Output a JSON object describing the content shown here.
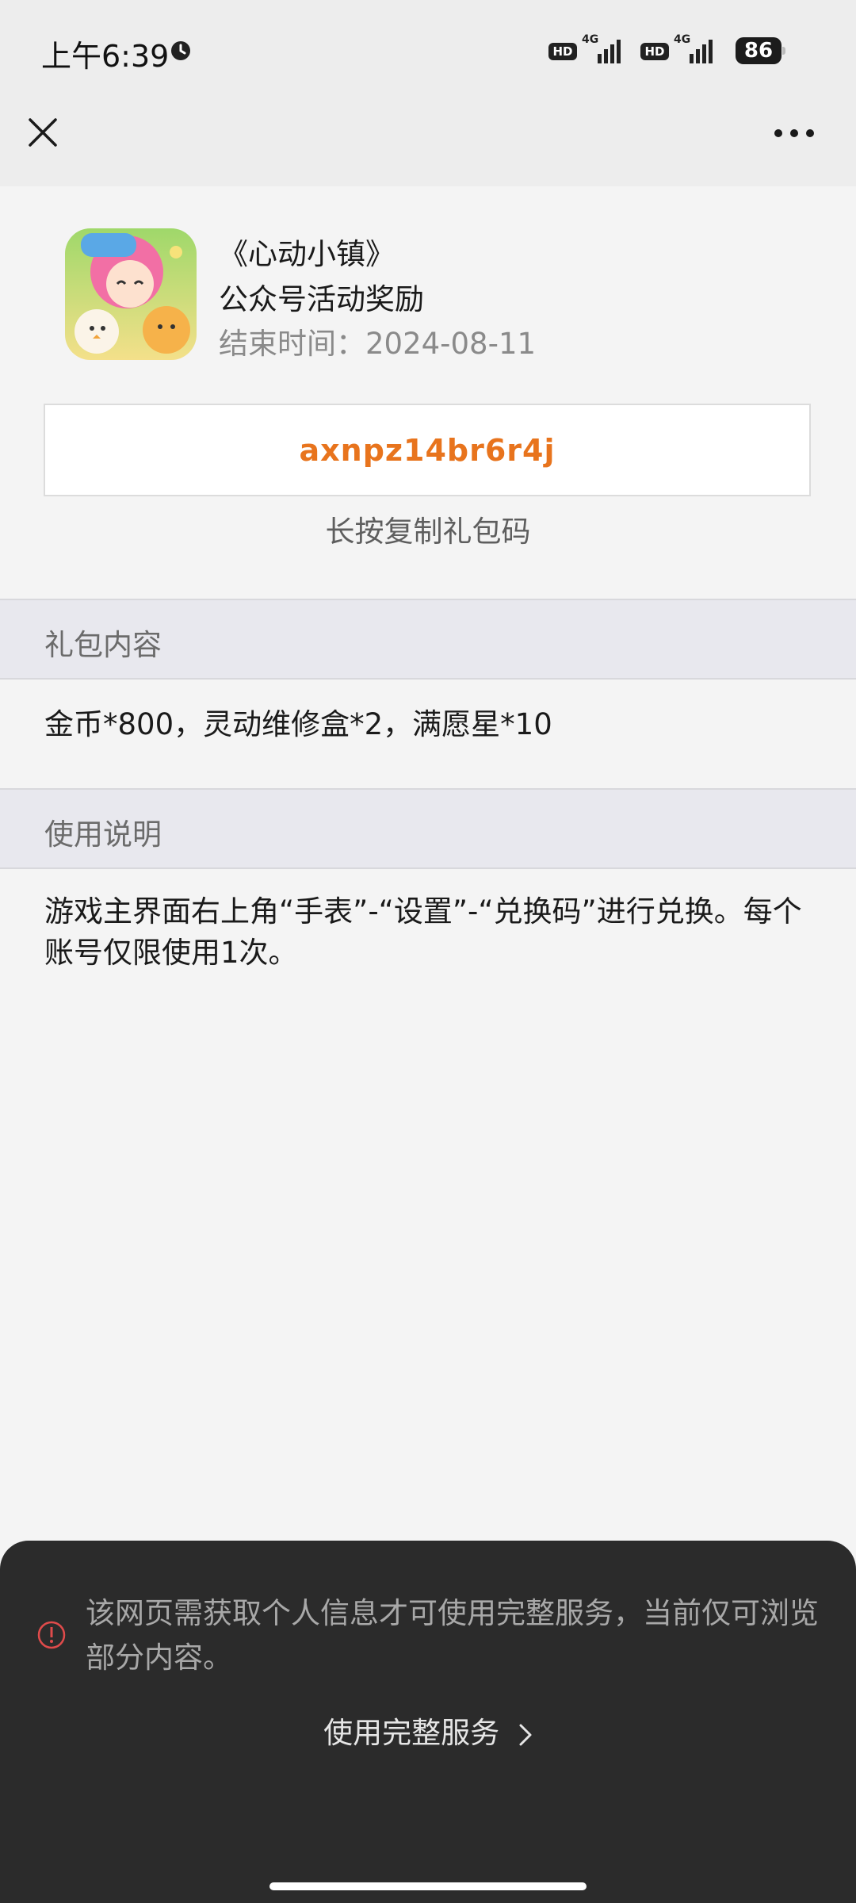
{
  "status_bar": {
    "time": "上午6:39",
    "hd1": "HD",
    "net1": "4G",
    "hd2": "HD",
    "net2": "4G",
    "battery": "86"
  },
  "header": {
    "close_icon": "close-icon",
    "more_icon": "more-horizontal-icon"
  },
  "gift": {
    "title": "《心动小镇》",
    "subtitle": "公众号活动奖励",
    "end_time": "结束时间：2024-08-11",
    "code": "axnpz14br6r4j",
    "copy_hint": "长按复制礼包码"
  },
  "sections": {
    "content_title": "礼包内容",
    "content_body": "金币*800，灵动维修盒*2，满愿星*10",
    "usage_title": "使用说明",
    "usage_body": "游戏主界面右上角“手表”-“设置”-“兑换码”进行兑换。每个账号仅限使用1次。"
  },
  "sheet": {
    "notice": "该网页需获取个人信息才可使用完整服务，当前仅可浏览部分内容。",
    "full_service_label": "使用完整服务",
    "warning_color": "#e04b4b"
  }
}
